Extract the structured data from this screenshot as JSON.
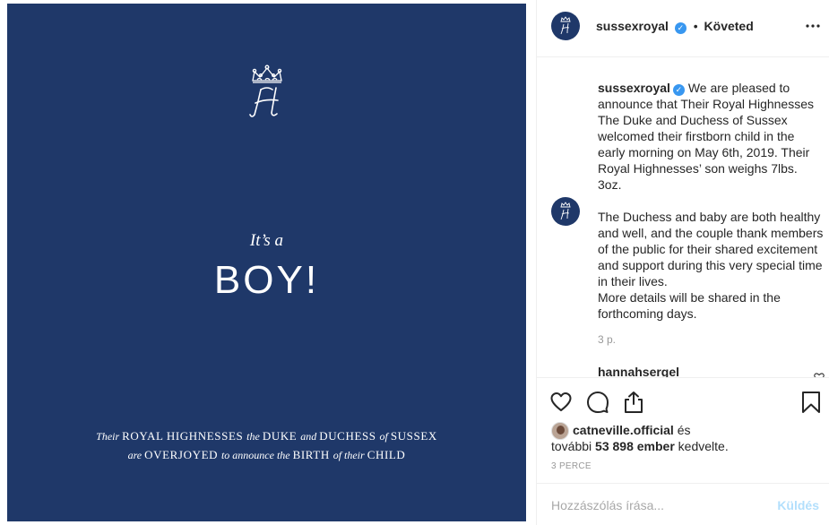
{
  "image": {
    "its_a": "It’s a",
    "boy": "BOY!",
    "line1": [
      {
        "t": "Their ",
        "it": true
      },
      {
        "t": "ROYAL HIGHNESSES ",
        "it": false
      },
      {
        "t": "the ",
        "it": true
      },
      {
        "t": "DUKE ",
        "it": false
      },
      {
        "t": "and ",
        "it": true
      },
      {
        "t": "DUCHESS ",
        "it": false
      },
      {
        "t": "of ",
        "it": true
      },
      {
        "t": "SUSSEX",
        "it": false
      }
    ],
    "line2": [
      {
        "t": "are ",
        "it": true
      },
      {
        "t": "OVERJOYED ",
        "it": false
      },
      {
        "t": "to announce the ",
        "it": true
      },
      {
        "t": "BIRTH ",
        "it": false
      },
      {
        "t": "of their ",
        "it": true
      },
      {
        "t": "CHILD",
        "it": false
      }
    ],
    "background_color": "#1f3869"
  },
  "header": {
    "username": "sussexroyal",
    "separator": "•",
    "follow_state": "Követed",
    "verified_color": "#3897f0"
  },
  "caption": {
    "username": "sussexroyal",
    "text_part1": " We are pleased to announce that Their Royal Highnesses The Duke and Duchess of Sussex welcomed their firstborn child in the early morning on May 6th, 2019. Their Royal Highnesses’ son weighs 7lbs. 3oz.",
    "text_part2": "The Duchess and baby are both healthy and well, and the couple thank members of the public for their shared excitement and support during this very special time in their lives.",
    "text_part3": "More details will be shared in the forthcoming days.",
    "time": "3 p."
  },
  "next_comment": {
    "username": "hannahsergel"
  },
  "likes": {
    "liker": "catneville.official",
    "and": " és",
    "others_prefix": "további ",
    "others_count": "53 898 ember",
    "suffix": " kedvelte."
  },
  "post_time": "3 PERCE",
  "add_comment": {
    "placeholder": "Hozzászólás írása...",
    "send_label": "Küldés"
  }
}
